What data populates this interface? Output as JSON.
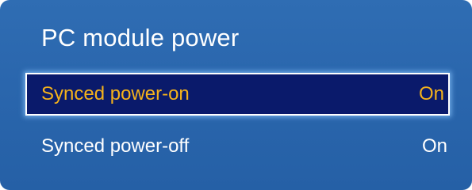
{
  "menu": {
    "title": "PC module power",
    "items": [
      {
        "label": "Synced power-on",
        "value": "On",
        "selected": true
      },
      {
        "label": "Synced power-off",
        "value": "On",
        "selected": false
      }
    ]
  },
  "colors": {
    "panel_background": "#2a66ad",
    "selected_background": "#0a1a6b",
    "selected_text": "#f5b21b",
    "normal_text": "#ffffff"
  }
}
